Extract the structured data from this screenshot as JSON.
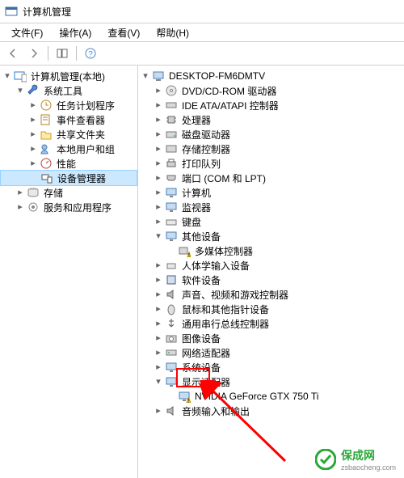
{
  "window": {
    "title": "计算机管理"
  },
  "menu": {
    "file": "文件(F)",
    "action": "操作(A)",
    "view": "查看(V)",
    "help": "帮助(H)"
  },
  "left_tree": {
    "root": "计算机管理(本地)",
    "system_tools": "系统工具",
    "task_scheduler": "任务计划程序",
    "event_viewer": "事件查看器",
    "shared_folders": "共享文件夹",
    "local_users": "本地用户和组",
    "performance": "性能",
    "device_manager": "设备管理器",
    "storage": "存储",
    "services_apps": "服务和应用程序"
  },
  "right_tree": {
    "root": "DESKTOP-FM6DMTV",
    "dvd": "DVD/CD-ROM 驱动器",
    "ide": "IDE ATA/ATAPI 控制器",
    "cpu": "处理器",
    "disk": "磁盘驱动器",
    "storage_ctrl": "存储控制器",
    "print": "打印队列",
    "ports": "端口 (COM 和 LPT)",
    "computer": "计算机",
    "monitor": "监视器",
    "keyboard": "键盘",
    "other_devices": "其他设备",
    "multimedia_ctrl": "多媒体控制器",
    "hid": "人体学输入设备",
    "software": "软件设备",
    "sound": "声音、视频和游戏控制器",
    "mouse": "鼠标和其他指针设备",
    "usb": "通用串行总线控制器",
    "image_devices": "图像设备",
    "network": "网络适配器",
    "system_devices": "系统设备",
    "display_adapters": "显示适配器",
    "gpu": "NVIDIA GeForce GTX 750 Ti",
    "audio_io": "音频输入和输出"
  },
  "watermark": {
    "brand": "保成网",
    "url": "zsbaocheng.com"
  }
}
